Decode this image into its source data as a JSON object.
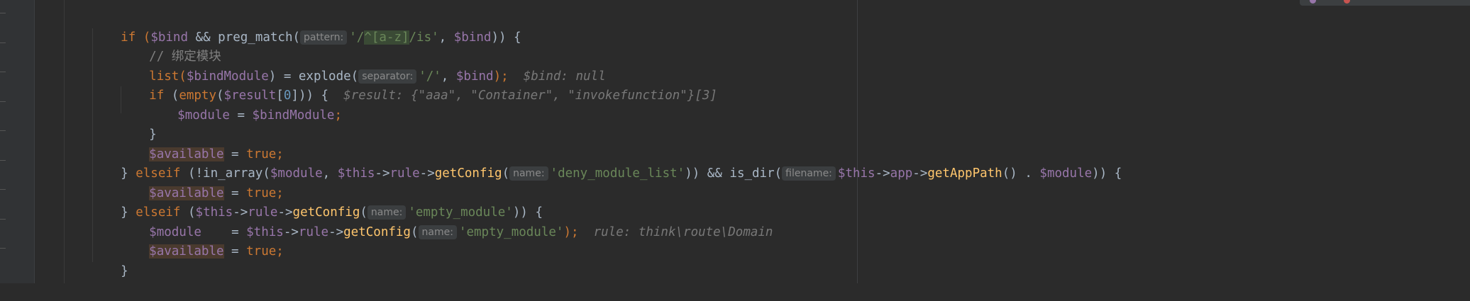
{
  "editor": {
    "lines": [
      {
        "prefix": "if (",
        "bind": "$bind",
        "mid": " && preg_match(",
        "hint_pattern": "pattern:",
        "regex_a": "'/",
        "regex_b": "^[a-z]",
        "regex_c": "/is'",
        "comma": ", ",
        "bind2": "$bind",
        "end": ")) {"
      },
      {
        "comment": "// 绑定模块"
      },
      {
        "list": "list(",
        "var": "$bindModule",
        "mid": ") = explode(",
        "hint_separator": "separator:",
        "str": "'/'",
        "comma": ", ",
        "bind": "$bind",
        "end": ");",
        "debug": "$bind: null"
      },
      {
        "kw": "if",
        "a": " (",
        "fn": "empty",
        "b": "(",
        "var": "$result",
        "c": "[",
        "num": "0",
        "d": "])) {",
        "debug": "$result: {\"aaa\", \"Container\", \"invokefunction\"}[3]"
      },
      {
        "var": "$module",
        "eq": " = ",
        "var2": "$bindModule",
        "semi": ";"
      },
      {
        "brace": "}"
      },
      {
        "var": "$available",
        "eq": " = ",
        "kw": "true",
        "semi": ";"
      },
      {
        "brace": "} ",
        "kw": "elseif",
        "a": " (!in_array(",
        "var": "$module",
        "comma": ", ",
        "this": "$this",
        "arrow": "->",
        "prop": "rule",
        "arrow2": "->",
        "fn": "getConfig",
        "p": "(",
        "hint_name": "name:",
        "str": "'deny_module_list'",
        "b": ")) && is_dir(",
        "hint_filename": "filename:",
        "this2": "$this",
        "arrow3": "->",
        "prop2": "app",
        "arrow4": "->",
        "fn2": "getAppPath",
        "c": "() . ",
        "var2": "$module",
        "d": ")) {"
      },
      {
        "var": "$available",
        "eq": " = ",
        "kw": "true",
        "semi": ";"
      },
      {
        "brace": "} ",
        "kw": "elseif",
        "a": " (",
        "this": "$this",
        "arrow": "->",
        "prop": "rule",
        "arrow2": "->",
        "fn": "getConfig",
        "p": "(",
        "hint_name": "name:",
        "str": "'empty_module'",
        "b": ")) {"
      },
      {
        "var": "$module",
        "sp": "    = ",
        "this": "$this",
        "arrow": "->",
        "prop": "rule",
        "arrow2": "->",
        "fn": "getConfig",
        "p": "(",
        "hint_name": "name:",
        "str": "'empty_module'",
        "end": ");",
        "debug": "rule: think\\route\\Domain"
      },
      {
        "var": "$available",
        "eq": " = ",
        "kw": "true",
        "semi": ";"
      },
      {
        "brace": "}"
      }
    ]
  }
}
